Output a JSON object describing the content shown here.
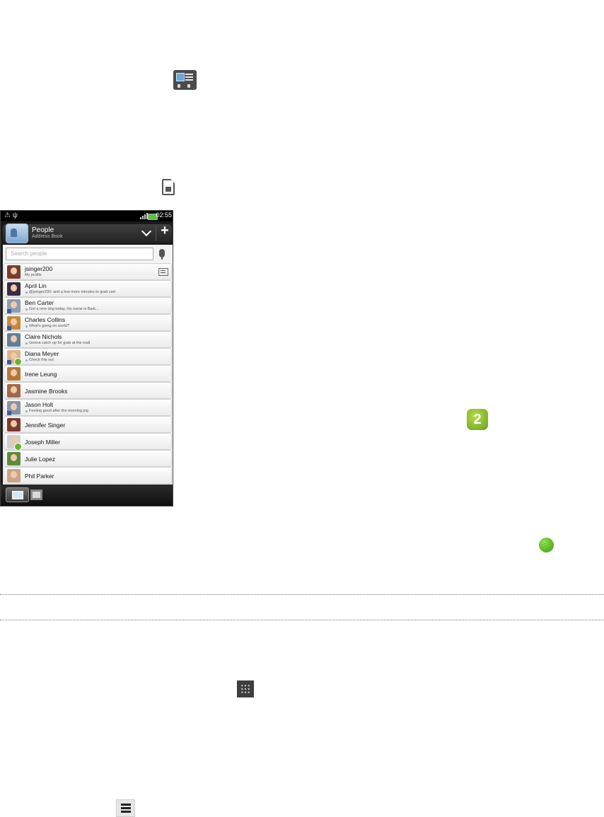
{
  "page_icons": {
    "contact_card": "contact-card-icon",
    "sim_card": "sim-card-icon",
    "grid": "all-apps-icon",
    "menu": "menu-icon",
    "online": "green-online-dot"
  },
  "badge": {
    "number": "2"
  },
  "phone": {
    "status_bar": {
      "time": "02:55",
      "left_icons": "⚠ ψ"
    },
    "header": {
      "title": "People",
      "subtitle": "Address Book",
      "add": "+"
    },
    "search": {
      "placeholder": "Search people"
    },
    "contacts": [
      {
        "name": "jsinger200",
        "status": "My profile"
      },
      {
        "name": "April Lin",
        "status": "@jsinger200: and a few more minutes to grad cart"
      },
      {
        "name": "Ben Carter",
        "status": "Got a new dog today, his name is Bark..."
      },
      {
        "name": "Charles Collins",
        "status": "What's going on world?"
      },
      {
        "name": "Claire Nichols",
        "status": "Gonna catch up for grab at the mall"
      },
      {
        "name": "Diana Meyer",
        "status": "Check this out"
      },
      {
        "name": "Irene Leung",
        "status": ""
      },
      {
        "name": "Jasmine Brooks",
        "status": ""
      },
      {
        "name": "Jason Holt",
        "status": "Feeling good after the morning jog"
      },
      {
        "name": "Jennifer Singer",
        "status": ""
      },
      {
        "name": "Joseph Miller",
        "status": ""
      },
      {
        "name": "Julie Lopez",
        "status": ""
      },
      {
        "name": "Phil Parker",
        "status": ""
      }
    ]
  }
}
